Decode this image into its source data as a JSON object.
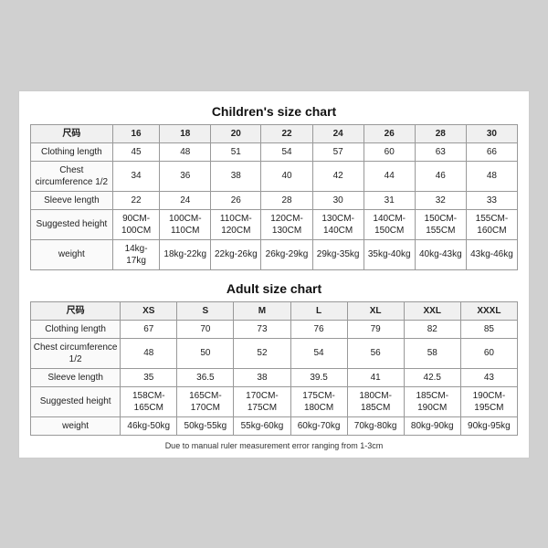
{
  "children_chart": {
    "title": "Children's size chart",
    "headers": [
      "尺码",
      "16",
      "18",
      "20",
      "22",
      "24",
      "26",
      "28",
      "30"
    ],
    "rows": [
      {
        "label": "Clothing length",
        "values": [
          "45",
          "48",
          "51",
          "54",
          "57",
          "60",
          "63",
          "66"
        ]
      },
      {
        "label": "Chest circumference 1/2",
        "values": [
          "34",
          "36",
          "38",
          "40",
          "42",
          "44",
          "46",
          "48"
        ]
      },
      {
        "label": "Sleeve length",
        "values": [
          "22",
          "24",
          "26",
          "28",
          "30",
          "31",
          "32",
          "33"
        ]
      },
      {
        "label": "Suggested height",
        "values": [
          "90CM-100CM",
          "100CM-110CM",
          "110CM-120CM",
          "120CM-130CM",
          "130CM-140CM",
          "140CM-150CM",
          "150CM-155CM",
          "155CM-160CM"
        ]
      },
      {
        "label": "weight",
        "values": [
          "14kg-17kg",
          "18kg-22kg",
          "22kg-26kg",
          "26kg-29kg",
          "29kg-35kg",
          "35kg-40kg",
          "40kg-43kg",
          "43kg-46kg"
        ]
      }
    ]
  },
  "adult_chart": {
    "title": "Adult size chart",
    "headers": [
      "尺码",
      "XS",
      "S",
      "M",
      "L",
      "XL",
      "XXL",
      "XXXL"
    ],
    "rows": [
      {
        "label": "Clothing length",
        "values": [
          "67",
          "70",
          "73",
          "76",
          "79",
          "82",
          "85"
        ]
      },
      {
        "label": "Chest circumference 1/2",
        "values": [
          "48",
          "50",
          "52",
          "54",
          "56",
          "58",
          "60"
        ]
      },
      {
        "label": "Sleeve length",
        "values": [
          "35",
          "36.5",
          "38",
          "39.5",
          "41",
          "42.5",
          "43"
        ]
      },
      {
        "label": "Suggested height",
        "values": [
          "158CM-165CM",
          "165CM-170CM",
          "170CM-175CM",
          "175CM-180CM",
          "180CM-185CM",
          "185CM-190CM",
          "190CM-195CM"
        ]
      },
      {
        "label": "weight",
        "values": [
          "46kg-50kg",
          "50kg-55kg",
          "55kg-60kg",
          "60kg-70kg",
          "70kg-80kg",
          "80kg-90kg",
          "90kg-95kg"
        ]
      }
    ]
  },
  "footnote": "Due to manual ruler measurement error ranging from 1-3cm"
}
